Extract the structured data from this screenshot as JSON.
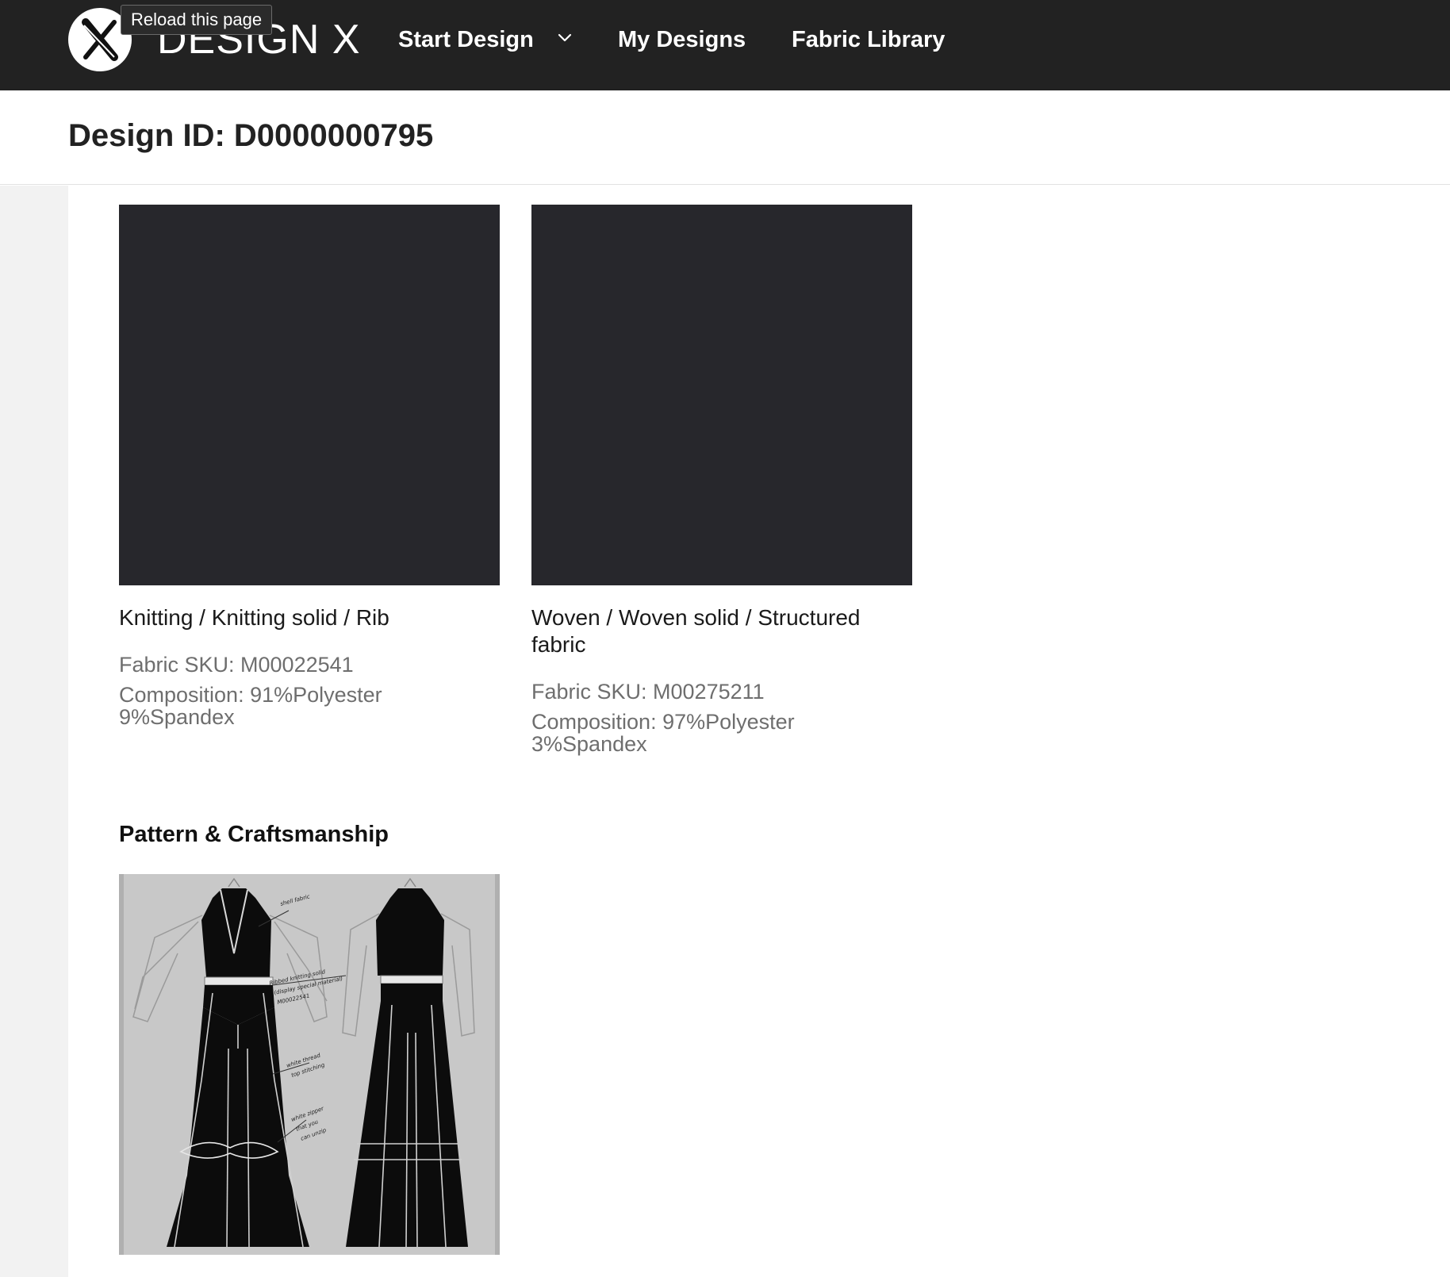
{
  "header": {
    "brand": "DESIGN X",
    "tooltip": "Reload this page",
    "nav": {
      "start_design": "Start Design",
      "my_designs": "My Designs",
      "fabric_library": "Fabric Library"
    },
    "colors": {
      "bar": "#222222",
      "text": "#ffffff"
    }
  },
  "page": {
    "title": "Design ID: D0000000795"
  },
  "fabrics": [
    {
      "name": "Knitting / Knitting solid / Rib",
      "sku": "Fabric SKU: M00022541",
      "composition": "Composition: 91%Polyester 9%Spandex",
      "swatch_color": "#27272c"
    },
    {
      "name": "Woven / Woven solid / Structured fabric",
      "sku": "Fabric SKU: M00275211",
      "composition": "Composition: 97%Polyester 3%Spandex",
      "swatch_color": "#27272c"
    }
  ],
  "pattern": {
    "title": "Pattern & Craftsmanship",
    "sketch_icon": "garment-sketch"
  }
}
